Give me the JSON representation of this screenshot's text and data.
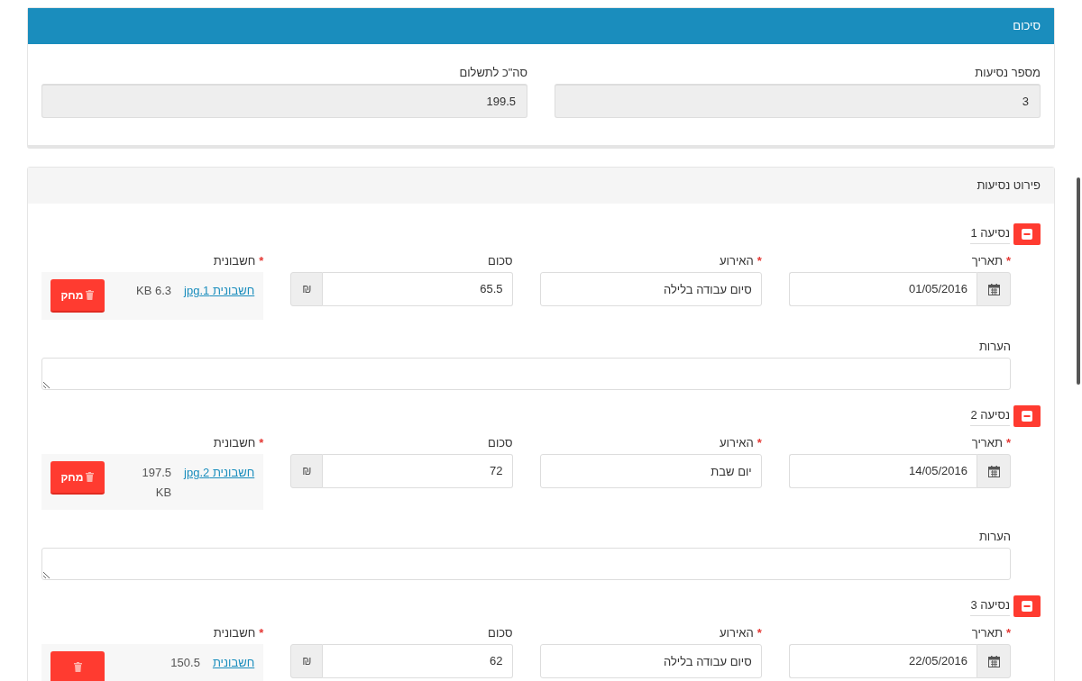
{
  "summary": {
    "title": "סיכום",
    "fields": [
      {
        "label": "מספר נסיעות",
        "value": "3"
      },
      {
        "label": "סה\"כ לתשלום",
        "value": "199.5"
      }
    ]
  },
  "trips_panel": {
    "title": "פירוט נסיעות",
    "trips": [
      {
        "title": "נסיעה 1",
        "date_mark": "*",
        "date_label": "תאריך",
        "date": "01/05/2016",
        "event_mark": "*",
        "event_label": "האירוע",
        "event": "סיום עבודה בלילה",
        "amount_label": "סכום",
        "amount": "65.5",
        "currency": "₪",
        "attachment_mark": "*",
        "attachment_label": "חשבונית",
        "file_name": "חשבונית 1.jpg",
        "file_size": "6.3 KB",
        "delete_label": "מחק",
        "notes_label": "הערות"
      },
      {
        "title": "נסיעה 2",
        "date_mark": "*",
        "date_label": "תאריך",
        "date": "14/05/2016",
        "event_mark": "*",
        "event_label": "האירוע",
        "event": "יום שבת",
        "amount_label": "סכום",
        "amount": "72",
        "currency": "₪",
        "attachment_mark": "*",
        "attachment_label": "חשבונית",
        "file_name": "חשבונית 2.jpg",
        "file_size": "197.5 KB",
        "delete_label": "מחק",
        "notes_label": "הערות"
      },
      {
        "title": "נסיעה 3",
        "date_mark": "*",
        "date_label": "תאריך",
        "date": "22/05/2016",
        "event_mark": "*",
        "event_label": "האירוע",
        "event": "סיום עבודה בלילה",
        "amount_label": "סכום",
        "amount": "62",
        "currency": "₪",
        "attachment_mark": "*",
        "attachment_label": "חשבונית",
        "file_name": "חשבונית",
        "file_size": "150.5"
      }
    ]
  }
}
